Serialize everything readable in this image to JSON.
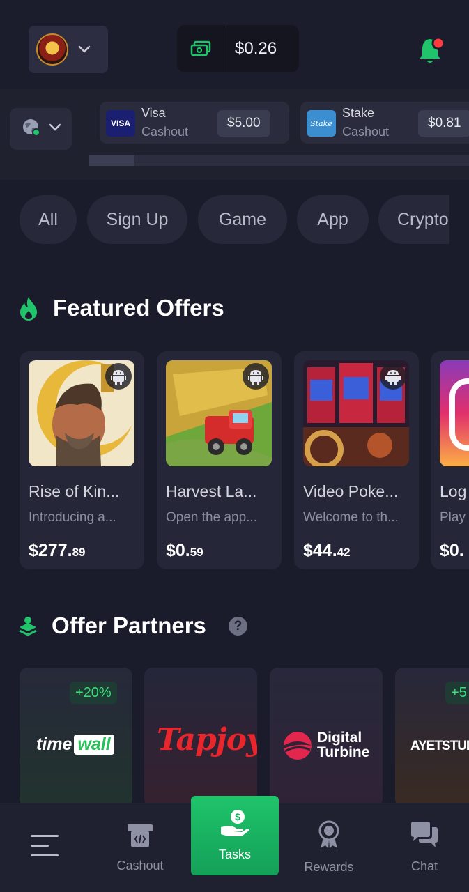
{
  "header": {
    "balance": "$0.26"
  },
  "cashouts": [
    {
      "logo": "VISA",
      "name": "Visa",
      "sub": "Cashout",
      "amount": "$5.00",
      "color": "#1a1f71"
    },
    {
      "logo": "Stake",
      "name": "Stake",
      "sub": "Cashout",
      "amount": "$0.81",
      "color": "#3b8fd1"
    }
  ],
  "categories": [
    "All",
    "Sign Up",
    "Game",
    "App",
    "Crypto"
  ],
  "featured": {
    "title": "Featured Offers",
    "offers": [
      {
        "title": "Rise of Kin...",
        "desc": "Introducing a...",
        "dollars": "$277.",
        "cents": "89"
      },
      {
        "title": "Harvest La...",
        "desc": "Open the app...",
        "dollars": "$0.",
        "cents": "59"
      },
      {
        "title": "Video Poke...",
        "desc": "Welcome to th...",
        "dollars": "$44.",
        "cents": "42"
      },
      {
        "title": "Log",
        "desc": "Play",
        "dollars": "$0.",
        "cents": ""
      }
    ]
  },
  "partners": {
    "title": "Offer Partners",
    "items": [
      {
        "name_a": "time",
        "name_b": "wall",
        "bonus": "+20%"
      },
      {
        "name": "Tapjoy",
        "bonus": ""
      },
      {
        "name_a": "Digital",
        "name_b": "Turbine",
        "bonus": ""
      },
      {
        "name": "AYETSTUDIOS",
        "bonus": "+5"
      }
    ]
  },
  "nav": {
    "cashout": "Cashout",
    "tasks": "Tasks",
    "rewards": "Rewards",
    "chat": "Chat"
  },
  "colors": {
    "accent": "#1fc46b",
    "background": "#1a1b2b",
    "card": "#252637",
    "notification_dot": "#ff3b3b"
  }
}
